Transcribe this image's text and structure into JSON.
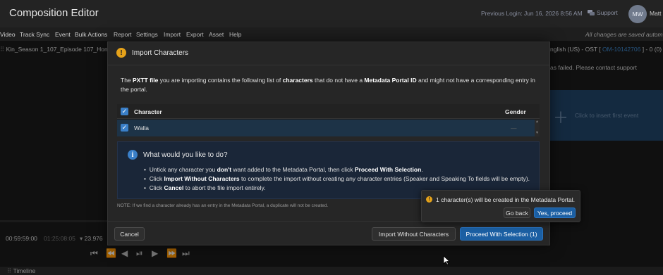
{
  "app": {
    "title": "Composition Editor",
    "previous_login": "Previous Login: Jun 16, 2026 8:56 AM",
    "support_label": "Support",
    "avatar_initials": "MW",
    "user_name": "Matt"
  },
  "menu": {
    "items": [
      "Video",
      "Track Sync",
      "Event",
      "Bulk Actions",
      "Report",
      "Settings",
      "Import",
      "Export",
      "Asset",
      "Help"
    ],
    "saved_status": "All changes are saved autom"
  },
  "background": {
    "episode_title": "Kin_Season 1_107_Episode 107_Hom",
    "language_prefix": "nglish (US) - OST [ ",
    "language_id": "OM-10142706",
    "language_suffix": " ] - 0 (0)",
    "fail_message": "as failed. Please contact support",
    "insert_hint": "Click to insert first event",
    "timecode_current": "00:59:59:00",
    "timecode_duration": "01:25:08:05",
    "fps": "23.976",
    "timeline_label": "Timeline"
  },
  "modal": {
    "title": "Import Characters",
    "intro_1": "The ",
    "intro_b1": "PXTT file",
    "intro_2": " you are importing contains the following list of ",
    "intro_b2": "characters",
    "intro_3": " that do not have a ",
    "intro_b3": "Metadata Portal ID",
    "intro_4": " and might not have a corresponding entry in the portal.",
    "table": {
      "col_character": "Character",
      "col_gender": "Gender",
      "rows": [
        {
          "name": "Walla",
          "gender": "—"
        }
      ]
    },
    "info": {
      "title": "What would you like to do?",
      "b1_a": "Untick any character you ",
      "b1_b": "don't",
      "b1_c": " want added to the Metadata Portal, then click ",
      "b1_d": "Proceed With Selection",
      "b1_e": ".",
      "b2_a": "Click ",
      "b2_b": "Import Without Characters",
      "b2_c": " to complete the import without creating any character entries (Speaker and Speaking To fields will be empty).",
      "b3_a": "Click ",
      "b3_b": "Cancel",
      "b3_c": " to abort the file import entirely."
    },
    "note": "NOTE: If we find a character already has an entry in the Metadata Portal, a duplicate will not be created.",
    "cancel_label": "Cancel",
    "import_without_label": "Import Without Characters",
    "proceed_label": "Proceed With Selection (1)"
  },
  "popover": {
    "message": "1 character(s) will be created in the Metadata Portal.",
    "go_back_label": "Go back",
    "yes_label": "Yes, proceed"
  },
  "colors": {
    "accent": "#1b5fa3",
    "warning": "#e5a21a",
    "info_bg": "#1a2638"
  }
}
